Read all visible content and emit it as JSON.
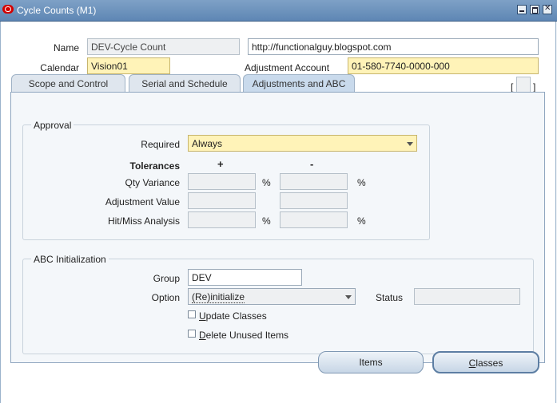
{
  "window": {
    "title": "Cycle Counts (M1)"
  },
  "header": {
    "name_label": "Name",
    "name_value": "DEV-Cycle Count",
    "description_value": "http://functionalguy.blogspot.com",
    "calendar_label": "Calendar",
    "calendar_value": "Vision01",
    "adjustment_account_label": "Adjustment Account",
    "adjustment_account_value": "01-580-7740-0000-000",
    "flex_open": "[",
    "flex_close": "]"
  },
  "tabs": [
    {
      "label": "Scope and Control"
    },
    {
      "label": "Serial and Schedule"
    },
    {
      "label": "Adjustments and ABC"
    }
  ],
  "approval": {
    "title": "Approval",
    "required_label": "Required",
    "required_value": "Always",
    "tolerances_label": "Tolerances",
    "plus_label": "+",
    "minus_label": "-",
    "percent": "%",
    "rows": [
      {
        "label": "Qty Variance"
      },
      {
        "label": "Adjustment Value"
      },
      {
        "label": "Hit/Miss Analysis"
      }
    ]
  },
  "abc": {
    "title": "ABC Initialization",
    "group_label": "Group",
    "group_value": "DEV",
    "option_label": "Option",
    "option_value": "(Re)initialize",
    "status_label": "Status",
    "status_value": "",
    "update_classes_first": "U",
    "update_classes_rest": "pdate Classes",
    "delete_unused_first": "D",
    "delete_unused_rest": "elete Unused Items"
  },
  "buttons": {
    "items_label": "Items",
    "classes_first": "C",
    "classes_rest": "lasses"
  },
  "colors": {
    "titlebar": "#5e86b4",
    "required_field": "#fff3b8",
    "active_tab": "#c9daec"
  }
}
